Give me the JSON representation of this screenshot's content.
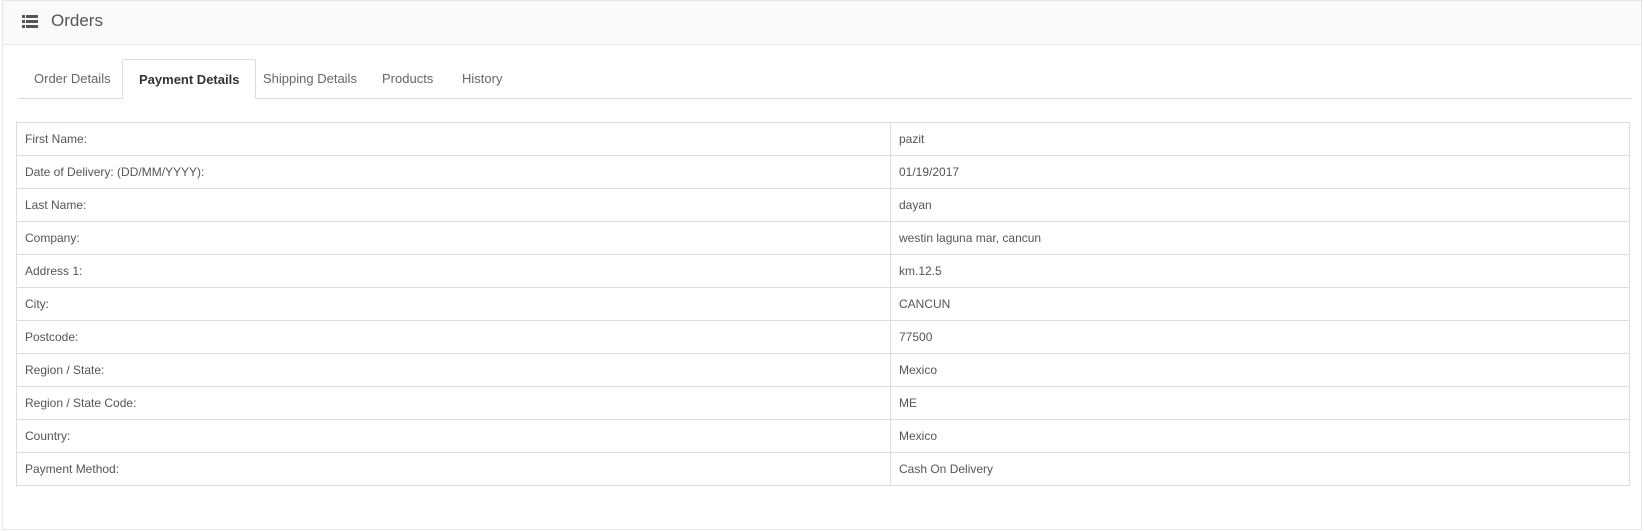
{
  "header": {
    "title": "Orders",
    "icon": "list-icon"
  },
  "tabs": [
    {
      "label": "Order Details",
      "active": false
    },
    {
      "label": "Payment Details",
      "active": true
    },
    {
      "label": "Shipping Details",
      "active": false
    },
    {
      "label": "Products",
      "active": false
    },
    {
      "label": "History",
      "active": false
    }
  ],
  "payment_details": {
    "rows": [
      {
        "label": "First Name:",
        "value": "pazit"
      },
      {
        "label": "Date of Delivery: (DD/MM/YYYY):",
        "value": "01/19/2017"
      },
      {
        "label": "Last Name:",
        "value": "dayan"
      },
      {
        "label": "Company:",
        "value": "westin laguna mar, cancun"
      },
      {
        "label": "Address 1:",
        "value": "km.12.5"
      },
      {
        "label": "City:",
        "value": "CANCUN"
      },
      {
        "label": "Postcode:",
        "value": "77500"
      },
      {
        "label": "Region / State:",
        "value": "Mexico"
      },
      {
        "label": "Region / State Code:",
        "value": "ME"
      },
      {
        "label": "Country:",
        "value": "Mexico"
      },
      {
        "label": "Payment Method:",
        "value": "Cash On Delivery"
      }
    ]
  },
  "colors": {
    "border": "#dddddd",
    "heading_bg": "#fafafa",
    "text": "#555555",
    "active_tab_text": "#333333"
  }
}
